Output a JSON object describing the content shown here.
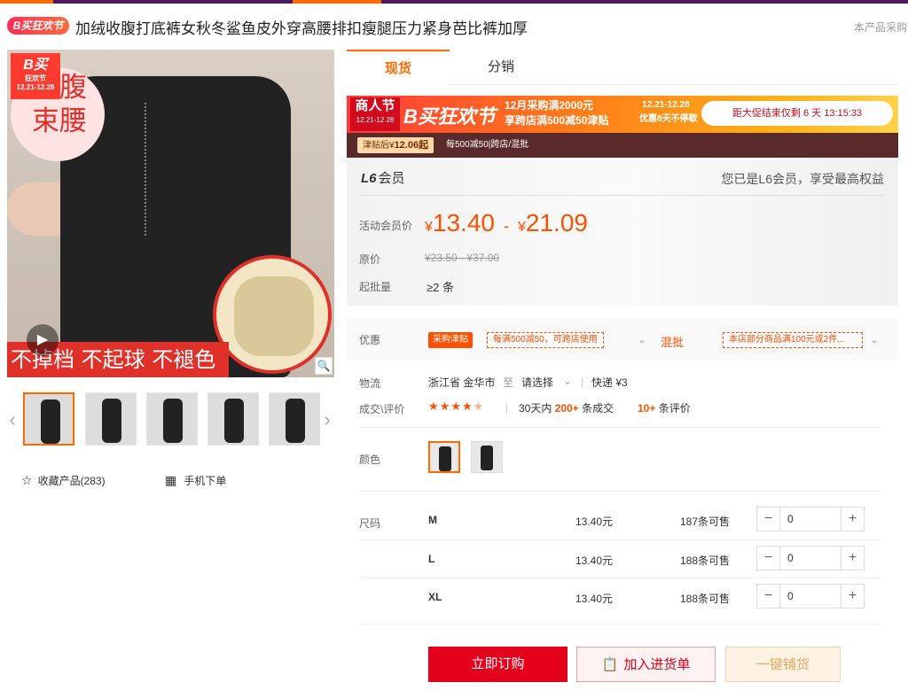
{
  "header": {
    "badge": "B买狂欢节",
    "title": "加绒收腹打底裤女秋冬鲨鱼皮外穿高腰排扣瘦腿压力紧身芭比裤加厚",
    "right_text": "本产品采购"
  },
  "gallery": {
    "sticker_title": "B买",
    "sticker_sub": "狂欢节",
    "sticker_date": "12.21-12.28",
    "tag_text": "收腹束腰",
    "bottom_text": "不掉档 不起球 不褪色",
    "thumb_count": 5
  },
  "actions": {
    "favorite_label": "收藏产品(283)",
    "mobile_label": "手机下单"
  },
  "tabs": [
    {
      "label": "现货",
      "active": true
    },
    {
      "label": "分销",
      "active": false
    }
  ],
  "banner": {
    "merchant_fest": "商人节",
    "merchant_date": "12.21-12.28",
    "fest_name": "B买狂欢节",
    "line1": "12月采购满2000元",
    "line2": "享跨店满500减50津贴",
    "date_range": "12.21-12.28",
    "discount": "优惠8天不停歇",
    "countdown": "距大促结束仅剩 6 天 13:15:33",
    "subsidy_chip_prefix": "津贴后¥",
    "subsidy_price": "12.06起",
    "subsidy_text": "每500减50|跨店/混批"
  },
  "member": {
    "level": "L6",
    "level_label": "会员",
    "notice": "您已是L6会员，享受最高权益"
  },
  "price": {
    "member_label": "活动会员价",
    "currency": "¥",
    "low": "13.40",
    "dash": "-",
    "high": "21.09",
    "orig_label": "原价",
    "orig_value": "¥23.50 - ¥37.00",
    "moq_label": "起批量",
    "moq_value": "≥2 条"
  },
  "promo": {
    "label": "优惠",
    "tag1": "采购津贴",
    "tag2": "每满500减50，可跨店使用",
    "mix": "混批",
    "tag3": "本店部分商品满100元或2件..."
  },
  "logistics": {
    "label": "物流",
    "origin": "浙江省 金华市",
    "to": "至",
    "dest": "请选择",
    "express": "快递 ¥3"
  },
  "deals": {
    "label": "成交\\评价",
    "rating": 4.5,
    "period": "30天内",
    "count": "200+",
    "count_suffix": "条成交",
    "reviews": "10+",
    "reviews_suffix": "条评价"
  },
  "color": {
    "label": "颜色",
    "swatch_count": 2
  },
  "sizes": {
    "label": "尺码",
    "rows": [
      {
        "name": "M",
        "price": "13.40元",
        "stock": "187条可售",
        "qty": "0"
      },
      {
        "name": "L",
        "price": "13.40元",
        "stock": "188条可售",
        "qty": "0"
      },
      {
        "name": "XL",
        "price": "13.40元",
        "stock": "188条可售",
        "qty": "0"
      }
    ]
  },
  "buttons": {
    "buy": "立即订购",
    "cart": "加入进货单",
    "one_click": "一键铺货"
  }
}
